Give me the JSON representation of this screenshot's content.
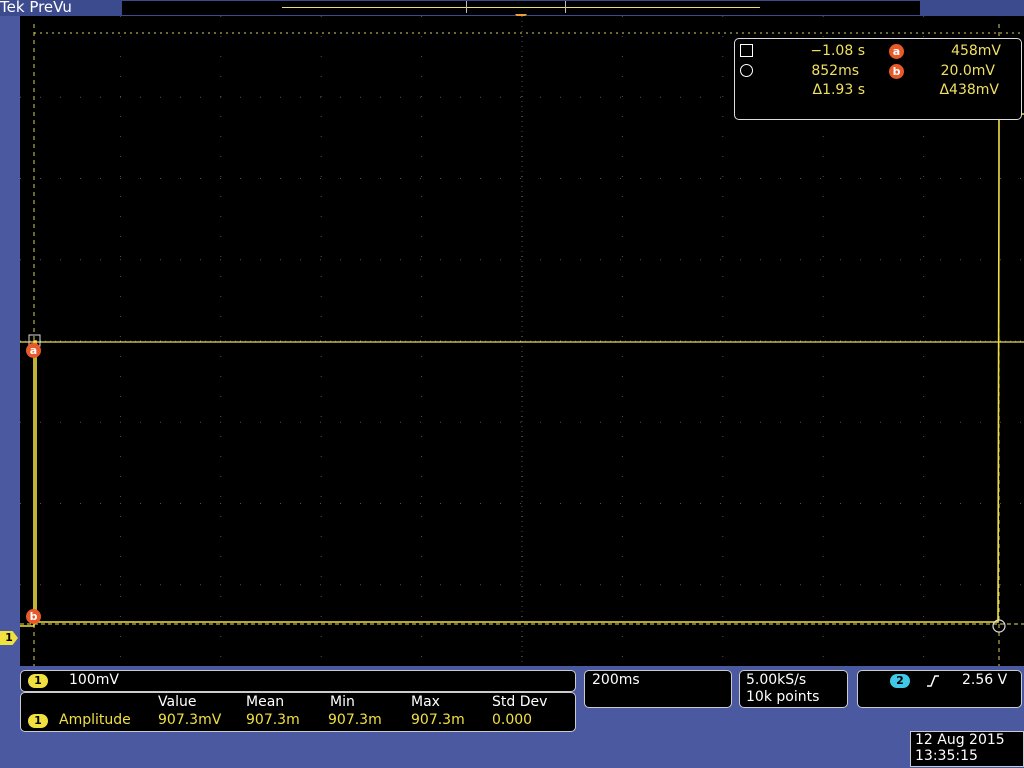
{
  "window": {
    "brand": "Tek",
    "mode": "PreVu"
  },
  "cursors": {
    "cursor1_time": "−1.08 s",
    "cursor2_time": "852ms",
    "delta_time": "Δ1.93 s",
    "cursor_a_label": "a",
    "cursor_b_label": "b",
    "cursor_a_value": "458mV",
    "cursor_b_value": "20.0mV",
    "delta_value": "Δ438mV"
  },
  "channel1": {
    "number": "1",
    "scale": "100mV"
  },
  "measurement": {
    "headers": [
      "Value",
      "Mean",
      "Min",
      "Max",
      "Std Dev"
    ],
    "name": "Amplitude",
    "values": [
      "907.3mV",
      "907.3m",
      "907.3m",
      "907.3m",
      "0.000"
    ]
  },
  "timebase": {
    "scale": "200ms"
  },
  "acquisition": {
    "rate": "5.00kS/s",
    "points": "10k points"
  },
  "trigger": {
    "source": "2",
    "level": "2.56 V"
  },
  "datetime": {
    "date": "12 Aug 2015",
    "time": "13:35:15"
  },
  "colors": {
    "trace": "#f0e040",
    "cursor_badge": "#e85a2a",
    "frame": "#4b5aa0",
    "screen": "#000000"
  },
  "icons": [
    "square-cursor-icon",
    "circle-cursor-icon",
    "rising-edge-icon",
    "trigger-position-icon",
    "channel1-ground-marker-icon"
  ]
}
